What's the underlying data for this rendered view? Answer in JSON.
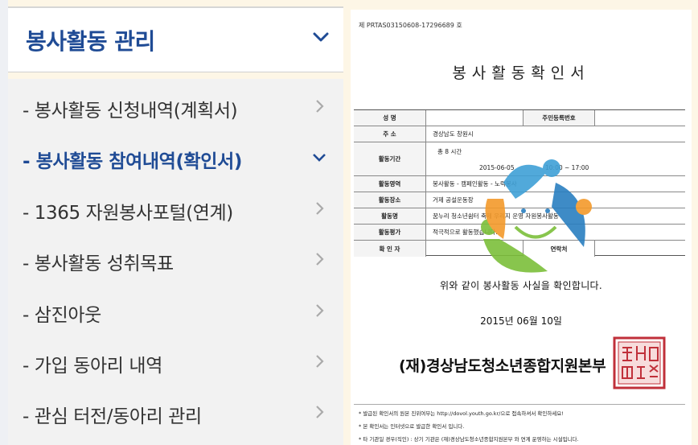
{
  "sidebar": {
    "header_title": "봉사활동 관리",
    "items": [
      {
        "label": "- 봉사활동 신청내역(계획서)",
        "active": false
      },
      {
        "label": "- 봉사활동 참여내역(확인서)",
        "active": true
      },
      {
        "label": "- 1365 자원봉사포털(연계)",
        "active": false
      },
      {
        "label": "- 봉사활동 성취목표",
        "active": false
      },
      {
        "label": "- 삼진아웃",
        "active": false
      },
      {
        "label": "- 가입 동아리 내역",
        "active": false
      },
      {
        "label": "- 관심 터전/동아리 관리",
        "active": false
      }
    ],
    "colors": {
      "accent": "#1f4b95",
      "text": "#333333",
      "chevron": "#aaaaaa"
    }
  },
  "certificate": {
    "serial": "제 PRTAS03150608-17296689 호",
    "title": "봉사활동확인서",
    "rows": {
      "name_label": "성    명",
      "rrn_label": "주민등록번호",
      "address_label": "주    소",
      "address_value": "경상남도 창원시",
      "period_label": "활동기간",
      "period_total": "총   8   시간",
      "period_date": "2015-06-05",
      "period_time": "10:00   ~     17:00",
      "field_label": "활동영역",
      "field_value": "봉사활동 - 캠페인활동 - 노력봉사",
      "place_label": "활동장소",
      "place_value": "거제 공설운동장",
      "activity_label": "활동명",
      "activity_value": "꿈누리 청소년쉼터 축제 우리지 운영 자원봉사활동",
      "evaluation_label": "활동평가",
      "evaluation_value": "적극적으로 활동했습니다.",
      "confirmer_label": "확 인 자",
      "contact_label": "연락처"
    },
    "confirm_text": "위와 같이 봉사활동 사실을 확인합니다.",
    "date": "2015년 06월 10일",
    "issuer": "(재)경상남도청소년종합지원본부",
    "seal_color": "#c0303a",
    "notes": [
      "* 발급된 확인서의 원본 진위여부는 http://dovol.youth.go.kr/으로 접속하셔서 확인하세요!",
      "* 본 확인서는 인터넷으로 발급한 확인서 입니다.",
      "* 타 기관일 경우(직인) : 상기 기관은 (재)경상남도청소년종합지원본부 와 연계 운영하는 시설입니다."
    ]
  }
}
